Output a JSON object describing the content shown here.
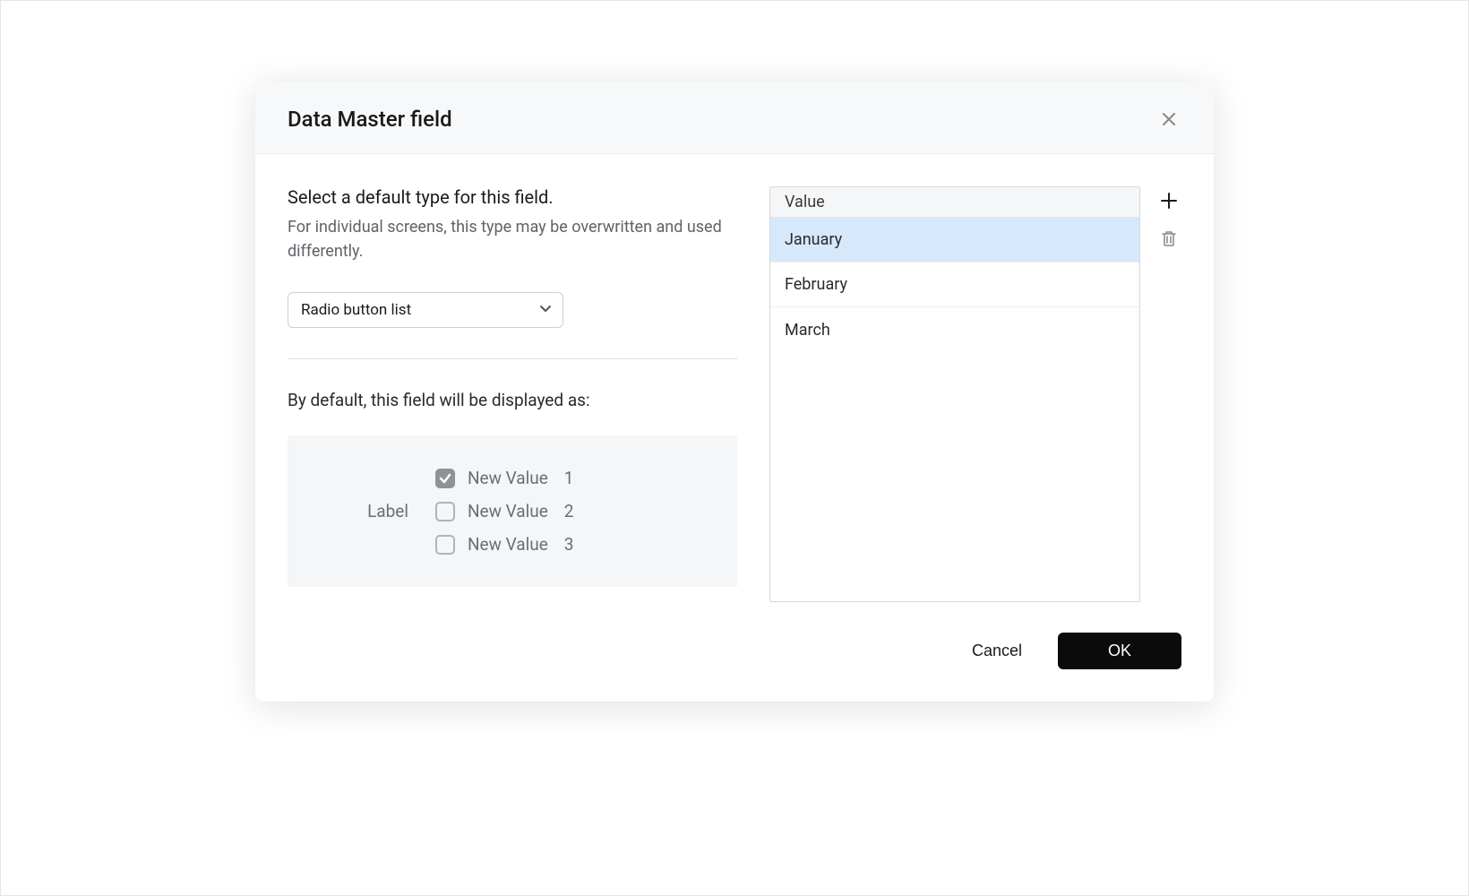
{
  "dialog": {
    "title": "Data Master field",
    "instruction_title": "Select a default type for this field.",
    "instruction_sub": "For individual screens, this type may be overwritten and used differently.",
    "type_select": {
      "selected": "Radio button list"
    },
    "displayed_as_label": "By default, this field will be displayed as:",
    "preview": {
      "label": "Label",
      "items": [
        {
          "text": "New Value",
          "num": "1",
          "checked": true
        },
        {
          "text": "New Value",
          "num": "2",
          "checked": false
        },
        {
          "text": "New Value",
          "num": "3",
          "checked": false
        }
      ]
    },
    "values": {
      "header": "Value",
      "items": [
        {
          "label": "January",
          "selected": true
        },
        {
          "label": "February",
          "selected": false
        },
        {
          "label": "March",
          "selected": false
        }
      ]
    },
    "footer": {
      "cancel": "Cancel",
      "ok": "OK"
    }
  }
}
